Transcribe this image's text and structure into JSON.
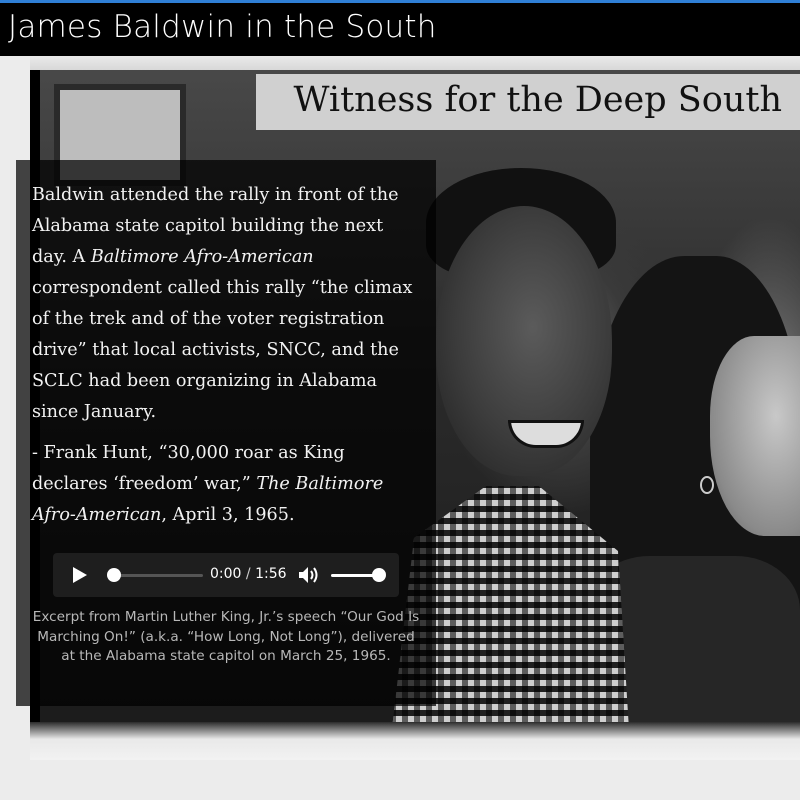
{
  "header": {
    "site_title": "James Baldwin in the South"
  },
  "banner": {
    "title": "Witness for the Deep South"
  },
  "caption": {
    "p1_part1": "Baldwin attended the rally in front of the Alabama state capitol building the next day. A ",
    "p1_italic": "Baltimore Afro-American",
    "p1_part2": " correspondent called this rally “the climax of the trek and of the voter registration drive” that local activists, SNCC, and the SCLC had been organizing in Alabama since January.",
    "p2_part1": "- Frank Hunt, “30,000 roar as King declares ‘freedom’ war,” ",
    "p2_italic": "The Baltimore Afro-American",
    "p2_part2": ", April 3, 1965."
  },
  "audio": {
    "current_time": "0:00",
    "separator": "/",
    "duration": "1:56",
    "progress": 0,
    "volume": 1.0,
    "play_icon": "play-icon",
    "volume_icon": "speaker-volume-icon",
    "caption": "Excerpt from Martin Luther King, Jr.’s speech “Our God Is Marching On!” (a.k.a. “How Long, Not Long”), delivered at the Alabama state capitol on March 25, 1965."
  },
  "colors": {
    "header_bg": "#000000",
    "header_accent": "#2f7fd6",
    "banner_bg": "#dcdcdc",
    "panel_bg": "rgba(0,0,0,0.72)"
  }
}
